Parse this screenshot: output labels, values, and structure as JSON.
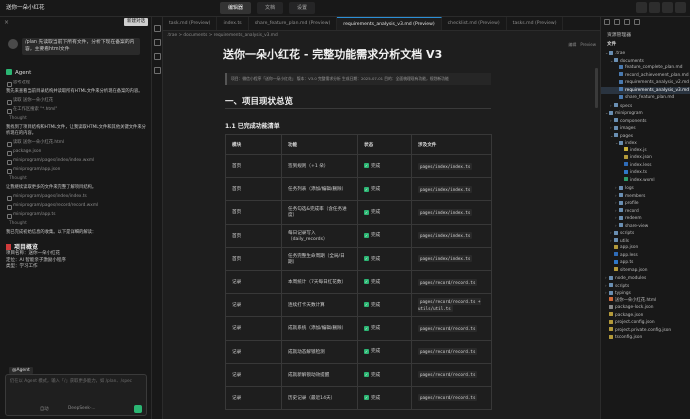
{
  "titlebar": {
    "app_name": "送你一朵小红花",
    "tabs": [
      "编辑器",
      "文档",
      "设置"
    ],
    "active_tab": 0
  },
  "left": {
    "close_glyph": "×",
    "new_button": "新建对话",
    "user_message": "/plan 先读取当前下所有文件，分析下现在备案的内容，主要看html文件",
    "agent_label": "Agent",
    "entries": [
      {
        "kind": "tool",
        "text": "思考过程"
      },
      {
        "kind": "para",
        "text": "我先来查看当前目录结构并读取所有HTML文件来分析现在备案的内容。"
      },
      {
        "kind": "tool",
        "text": "读取 送你一朵小红花"
      },
      {
        "kind": "tool",
        "text": "在工作区搜索 \"*.html\""
      },
      {
        "kind": "thought",
        "text": "Thought"
      },
      {
        "kind": "para",
        "text": "我找到了项目结构和HTML文件，让我读取HTML文件和其他关键文件来分析现在的内容。"
      },
      {
        "kind": "tool",
        "text": "读取 送你一朵小红花.html"
      },
      {
        "kind": "tool",
        "text": "package.json"
      },
      {
        "kind": "tool",
        "text": "miniprogram/pages/index/index.wxml"
      },
      {
        "kind": "tool",
        "text": "miniprogram/app.json"
      },
      {
        "kind": "thought",
        "text": "Thought"
      },
      {
        "kind": "para",
        "text": "让我继续读取更多的文件来完整了解项目结构。"
      },
      {
        "kind": "tool",
        "text": "miniprogram/pages/index/index.ts"
      },
      {
        "kind": "tool",
        "text": "miniprogram/pages/record/record.wxml"
      },
      {
        "kind": "tool",
        "text": "miniprogram/app.ts"
      },
      {
        "kind": "thought",
        "text": "Thought"
      },
      {
        "kind": "para",
        "text": "我已完成初始信息的收集。以下是详细的解读："
      }
    ],
    "section_title": "项目概览",
    "kv": [
      "项目名称：送你一朵小红花",
      "定位：AI 智能亲子激励小程序",
      "类型：学习工作"
    ],
    "composer": {
      "mention": "@Agent",
      "placeholder": "仍在以 Agent 模式，输入「/」获取更多能力，如 /plan、/spec",
      "selector": "自动",
      "model": "DeepSeek-..."
    }
  },
  "editor": {
    "tabs": [
      {
        "label": "task.md (Preview)",
        "active": false
      },
      {
        "label": "index.ts",
        "active": false
      },
      {
        "label": "share_feature_plan.md (Preview)",
        "active": false
      },
      {
        "label": "requirements_analysis_v3.md (Preview)",
        "active": true
      },
      {
        "label": "checklist.md (Preview)",
        "active": false
      },
      {
        "label": "tasks.md (Preview)",
        "active": false
      }
    ],
    "breadcrumb": ".trae  >  documents  >  requirements_analysis_v3.md",
    "toolbar": [
      "编辑",
      "Preview"
    ],
    "doc": {
      "title": "送你一朵小红花 - 完整功能需求分析文档 V3",
      "meta": "项目：微信小程序「送你一朵小红花」 版本：V3.0 完整需求分析 生成日期：2025-07-01 目的：全面梳理现有功能，规划新功能",
      "h2": "一、项目现状总览",
      "h3": "1.1 已完成功能清单",
      "columns": [
        "模块",
        "功能",
        "状态",
        "涉及文件"
      ],
      "rows": [
        [
          "首页",
          "签到规则（+1 朵）",
          "完成",
          "pages/index/index.ts"
        ],
        [
          "首页",
          "任务列表（添加/编辑/删除）",
          "完成",
          "pages/index/index.ts"
        ],
        [
          "首页",
          "任务勾选&完成率（含任务进度）",
          "完成",
          "pages/index/index.ts"
        ],
        [
          "首页",
          "每日记录写入（daily_records）",
          "完成",
          "pages/index/index.ts"
        ],
        [
          "首页",
          "任务完整生命周期（全局/日期）",
          "完成",
          "pages/index/index.ts"
        ],
        [
          "记录",
          "本周统计（7天每日红花数）",
          "完成",
          "pages/record/record.ts"
        ],
        [
          "记录",
          "连续打卡天数计算",
          "完成",
          "pages/record/record.ts + utils/util.ts"
        ],
        [
          "记录",
          "成就系统（添加/编辑/删除）",
          "完成",
          "pages/record/record.ts"
        ],
        [
          "记录",
          "成就动态解锁检测",
          "完成",
          "pages/record/record.ts"
        ],
        [
          "记录",
          "成就新解锁动效提醒",
          "完成",
          "pages/record/record.ts"
        ],
        [
          "记录",
          "历史记录（最近14天）",
          "完成",
          "pages/record/record.ts"
        ]
      ]
    }
  },
  "explorer": {
    "title": "资源管理器",
    "section": "文件",
    "tree": [
      {
        "depth": 0,
        "chev": "v",
        "icon": "folder",
        "label": ".trae"
      },
      {
        "depth": 1,
        "chev": "v",
        "icon": "folder",
        "label": "documents"
      },
      {
        "depth": 2,
        "chev": "",
        "icon": "md",
        "label": "feature_complete_plan.md"
      },
      {
        "depth": 2,
        "chev": "",
        "icon": "md",
        "label": "record_achievement_plan.md"
      },
      {
        "depth": 2,
        "chev": "",
        "icon": "md",
        "label": "requirements_analysis_v2.md"
      },
      {
        "depth": 2,
        "chev": "",
        "icon": "md",
        "label": "requirements_analysis_v3.md",
        "selected": true
      },
      {
        "depth": 2,
        "chev": "",
        "icon": "md",
        "label": "share_feature_plan.md"
      },
      {
        "depth": 1,
        "chev": ">",
        "icon": "folder",
        "label": "specs"
      },
      {
        "depth": 0,
        "chev": "v",
        "icon": "folder",
        "label": "miniprogram"
      },
      {
        "depth": 1,
        "chev": ">",
        "icon": "folder",
        "label": "components"
      },
      {
        "depth": 1,
        "chev": ">",
        "icon": "folder",
        "label": "images"
      },
      {
        "depth": 1,
        "chev": "v",
        "icon": "folder",
        "label": "pages"
      },
      {
        "depth": 2,
        "chev": "v",
        "icon": "folder",
        "label": "index"
      },
      {
        "depth": 3,
        "chev": "",
        "icon": "js",
        "label": "index.js"
      },
      {
        "depth": 3,
        "chev": "",
        "icon": "json",
        "label": "index.json"
      },
      {
        "depth": 3,
        "chev": "",
        "icon": "less",
        "label": "index.less"
      },
      {
        "depth": 3,
        "chev": "",
        "icon": "ts",
        "label": "index.ts"
      },
      {
        "depth": 3,
        "chev": "",
        "icon": "wxml",
        "label": "index.wxml"
      },
      {
        "depth": 2,
        "chev": ">",
        "icon": "folder",
        "label": "logs"
      },
      {
        "depth": 2,
        "chev": ">",
        "icon": "folder",
        "label": "members"
      },
      {
        "depth": 2,
        "chev": ">",
        "icon": "folder",
        "label": "profile"
      },
      {
        "depth": 2,
        "chev": ">",
        "icon": "folder",
        "label": "record"
      },
      {
        "depth": 2,
        "chev": ">",
        "icon": "folder",
        "label": "redeem"
      },
      {
        "depth": 2,
        "chev": ">",
        "icon": "folder",
        "label": "share-view"
      },
      {
        "depth": 1,
        "chev": ">",
        "icon": "folder",
        "label": "scripts"
      },
      {
        "depth": 1,
        "chev": ">",
        "icon": "folder",
        "label": "utils"
      },
      {
        "depth": 1,
        "chev": "",
        "icon": "json",
        "label": "app.json"
      },
      {
        "depth": 1,
        "chev": "",
        "icon": "less",
        "label": "app.less"
      },
      {
        "depth": 1,
        "chev": "",
        "icon": "ts",
        "label": "app.ts"
      },
      {
        "depth": 1,
        "chev": "",
        "icon": "json",
        "label": "sitemap.json"
      },
      {
        "depth": 0,
        "chev": ">",
        "icon": "folder",
        "label": "node_modules"
      },
      {
        "depth": 0,
        "chev": ">",
        "icon": "folder",
        "label": "scripts"
      },
      {
        "depth": 0,
        "chev": ">",
        "icon": "folder",
        "label": "typings"
      },
      {
        "depth": 0,
        "chev": "",
        "icon": "html",
        "label": "送你一朵小红花.html"
      },
      {
        "depth": 0,
        "chev": "",
        "icon": "lock",
        "label": "package-lock.json"
      },
      {
        "depth": 0,
        "chev": "",
        "icon": "json",
        "label": "package.json"
      },
      {
        "depth": 0,
        "chev": "",
        "icon": "json",
        "label": "project.config.json"
      },
      {
        "depth": 0,
        "chev": "",
        "icon": "json",
        "label": "project.private.config.json"
      },
      {
        "depth": 0,
        "chev": "",
        "icon": "json",
        "label": "tsconfig.json"
      }
    ],
    "outline": "大纲"
  }
}
